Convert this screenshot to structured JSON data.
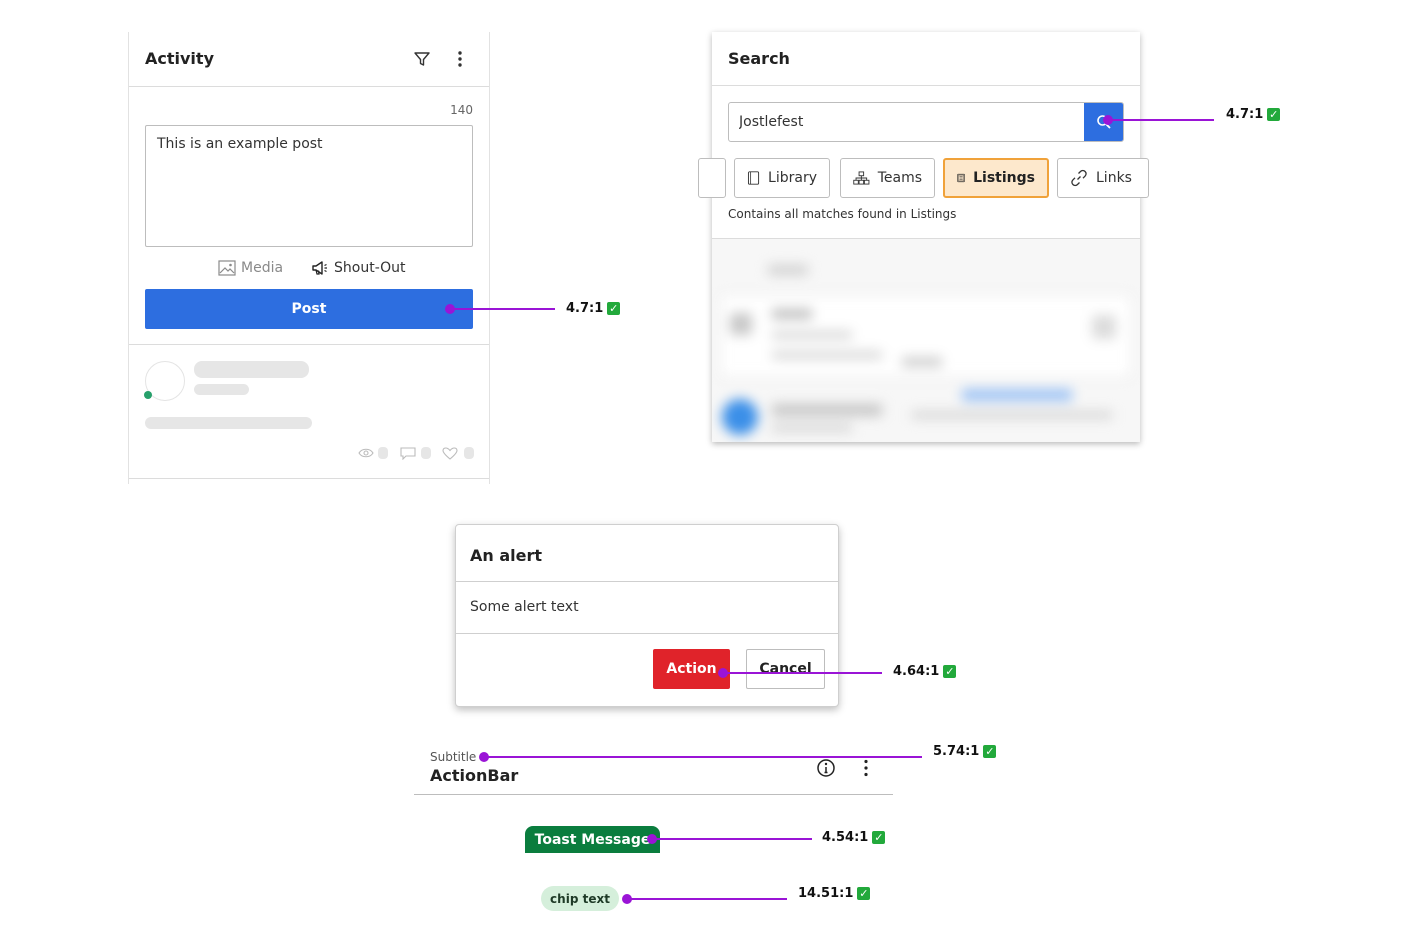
{
  "activity": {
    "title": "Activity",
    "char_count": "140",
    "post_text": "This is an example post",
    "media_label": "Media",
    "shoutout_label": "Shout-Out",
    "post_button": "Post"
  },
  "search": {
    "title": "Search",
    "query": "Jostlefest",
    "tabs": [
      {
        "label": "Library",
        "icon": "book-icon"
      },
      {
        "label": "Teams",
        "icon": "org-chart-icon"
      },
      {
        "label": "Listings",
        "icon": "document-list-icon",
        "active": true
      },
      {
        "label": "Links",
        "icon": "link-icon"
      }
    ],
    "helper_text": "Contains all matches found in Listings"
  },
  "alert": {
    "title": "An alert",
    "body": "Some alert text",
    "action_label": "Action",
    "cancel_label": "Cancel"
  },
  "actionbar": {
    "subtitle": "Subtitle",
    "title": "ActionBar"
  },
  "toast": {
    "text": "Toast Message"
  },
  "chip": {
    "text": "chip text"
  },
  "annotations": [
    {
      "ratio": "4.7:1",
      "status": "pass"
    },
    {
      "ratio": "4.7:1",
      "status": "pass"
    },
    {
      "ratio": "4.64:1",
      "status": "pass"
    },
    {
      "ratio": "5.74:1",
      "status": "pass"
    },
    {
      "ratio": "4.54:1",
      "status": "pass"
    },
    {
      "ratio": "14.51:1",
      "status": "pass"
    }
  ],
  "colors": {
    "primary": "#2d6ee0",
    "danger": "#e0232a",
    "toast": "#0a7d3e",
    "chip_bg": "#d5efdb",
    "active_tab_bg": "#fde8cc",
    "active_tab_border": "#f0a23a",
    "annotation": "#9a14d6",
    "check": "#22a93b",
    "online": "#27a06b"
  }
}
